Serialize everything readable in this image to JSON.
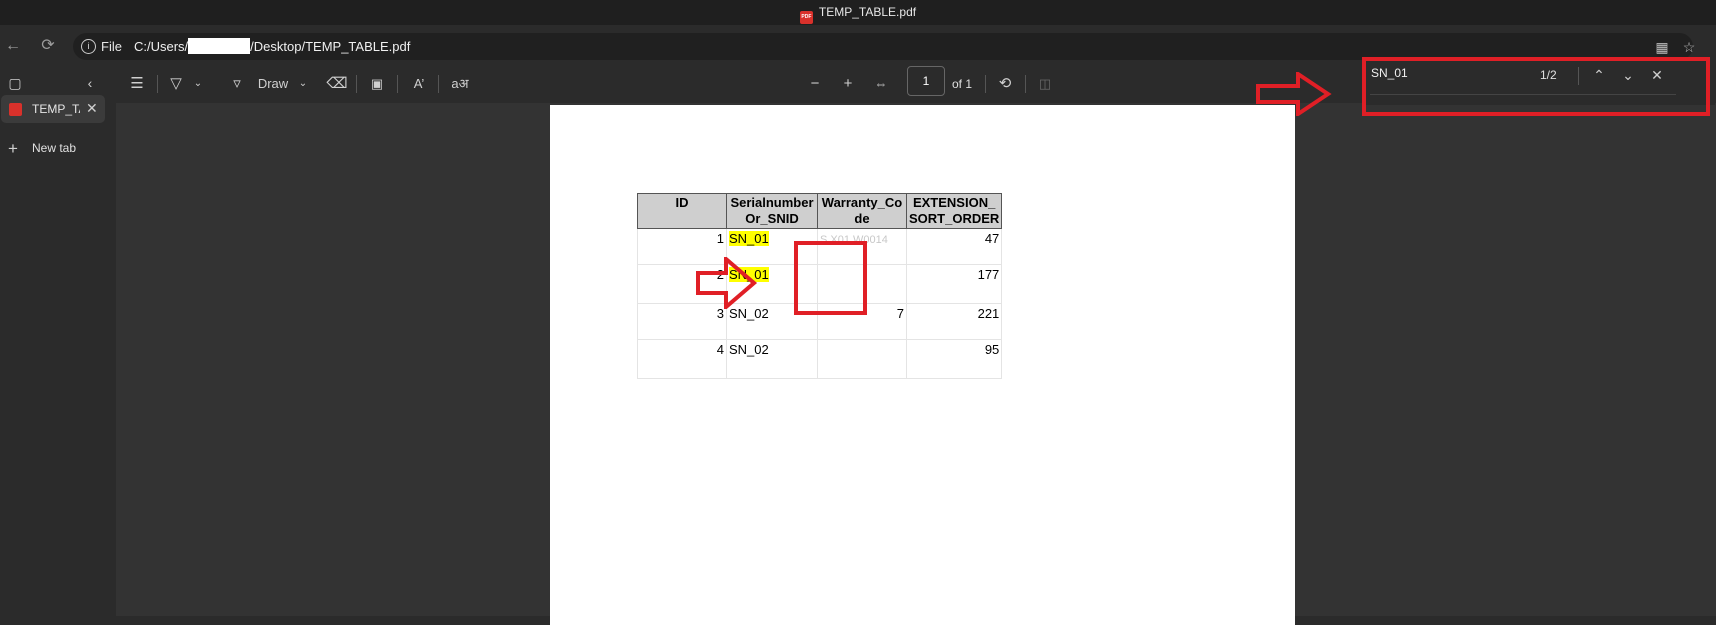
{
  "window": {
    "title": "TEMP_TABLE.pdf"
  },
  "address_bar": {
    "scheme_label": "File",
    "url_prefix": "C:/Users/",
    "url_suffix": "/Desktop/TEMP_TABLE.pdf"
  },
  "sidebar": {
    "tabs": [
      {
        "label": "TEMP_TABLE.pdf"
      }
    ],
    "new_tab_label": "New tab"
  },
  "toolbar": {
    "draw_label": "Draw",
    "page_number": "1",
    "page_total": "of 1"
  },
  "find_bar": {
    "query": "SN_01",
    "match_count": "1/2"
  },
  "table": {
    "headers": [
      "ID",
      "Serialnumber_Or_SNID",
      "Warranty_Code",
      "EXTENSION_SORT_ORDER"
    ],
    "header_display": [
      "ID",
      "Serialnumber\nOr_SNID",
      "Warranty_Co\nde",
      "EXTENSION_\nSORT_ORDER"
    ],
    "rows": [
      {
        "id": "1",
        "serial": "SN_01",
        "warranty_hint": "S X01 W0014",
        "ext": "47",
        "highlighted": true
      },
      {
        "id": "2",
        "serial": "SN_01",
        "warranty_hint": "",
        "ext": "177",
        "highlighted": true
      },
      {
        "id": "3",
        "serial": "SN_02",
        "warranty_hint": "7",
        "ext": "221",
        "highlighted": false
      },
      {
        "id": "4",
        "serial": "SN_02",
        "warranty_hint": "",
        "ext": "95",
        "highlighted": false
      }
    ]
  },
  "colors": {
    "annotation_red": "#e01f26",
    "search_highlight": "#ffff00",
    "header_fill": "#cfcfcf"
  }
}
